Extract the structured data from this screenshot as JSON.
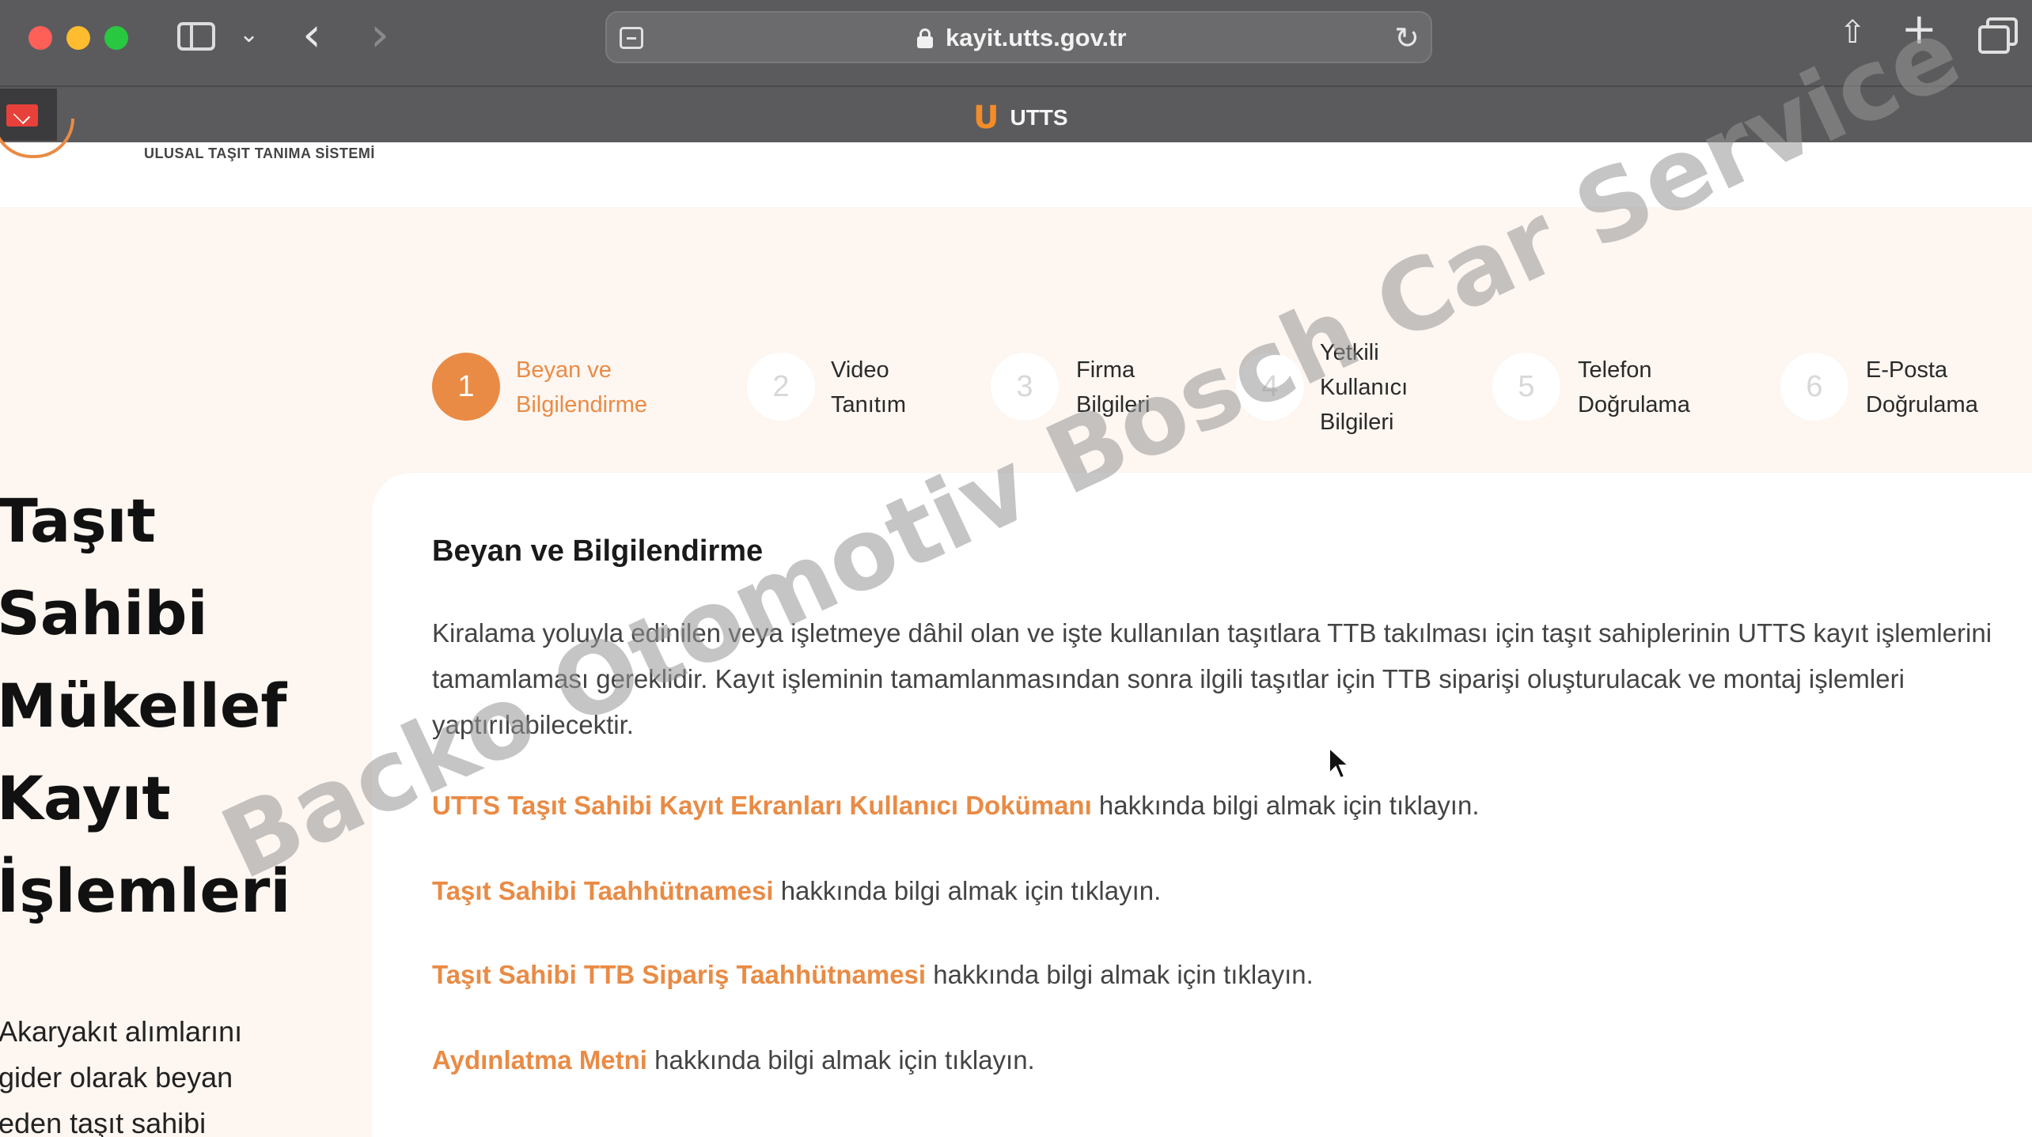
{
  "browser": {
    "url": "kayit.utts.gov.tr",
    "tab_logo": "U",
    "tab_title": "UTTS"
  },
  "site": {
    "tagline": "ULUSAL TAŞIT TANIMA SİSTEMİ"
  },
  "steps": [
    {
      "number": "1",
      "label": "Beyan ve\nBilgilendirme",
      "active": true
    },
    {
      "number": "2",
      "label": "Video\nTanıtım",
      "active": false
    },
    {
      "number": "3",
      "label": "Firma\nBilgileri",
      "active": false
    },
    {
      "number": "4",
      "label": "Yetkili\nKullanıcı\nBilgileri",
      "active": false
    },
    {
      "number": "5",
      "label": "Telefon\nDoğrulama",
      "active": false
    },
    {
      "number": "6",
      "label": "E-Posta\nDoğrulama",
      "active": false
    }
  ],
  "left": {
    "title": "Taşıt\nSahibi\nMükellef\nKayıt\nİşlemleri",
    "description": "Akaryakıt alımlarını\ngider olarak beyan\neden taşıt sahibi"
  },
  "card": {
    "title": "Beyan ve Bilgilendirme",
    "text": "Kiralama yoluyla edinilen veya işletmeye dâhil olan ve işte kullanılan taşıtlara TTB takılması için taşıt sahiplerinin UTTS kayıt işlemlerini tamamlaması gereklidir. Kayıt işleminin tamamlanmasından sonra ilgili taşıtlar için TTB siparişi oluşturulacak ve montaj işlemleri yaptırılabilecektir.",
    "links": [
      {
        "link": "UTTS Taşıt Sahibi Kayıt Ekranları Kullanıcı Dokümanı",
        "suffix": " hakkında bilgi almak için tıklayın."
      },
      {
        "link": "Taşıt Sahibi Taahhütnamesi",
        "suffix": " hakkında bilgi almak için tıklayın."
      },
      {
        "link": "Taşıt Sahibi TTB Sipariş Taahhütnamesi",
        "suffix": " hakkında bilgi almak için tıklayın."
      },
      {
        "link": "Aydınlatma Metni",
        "suffix": " hakkında bilgi almak için tıklayın."
      }
    ]
  },
  "watermark": "Backo Otomotiv Bosch Car Service",
  "colors": {
    "accent": "#e98b45",
    "chrome": "#5b5b5d",
    "page_bg": "#fdf6f1"
  }
}
